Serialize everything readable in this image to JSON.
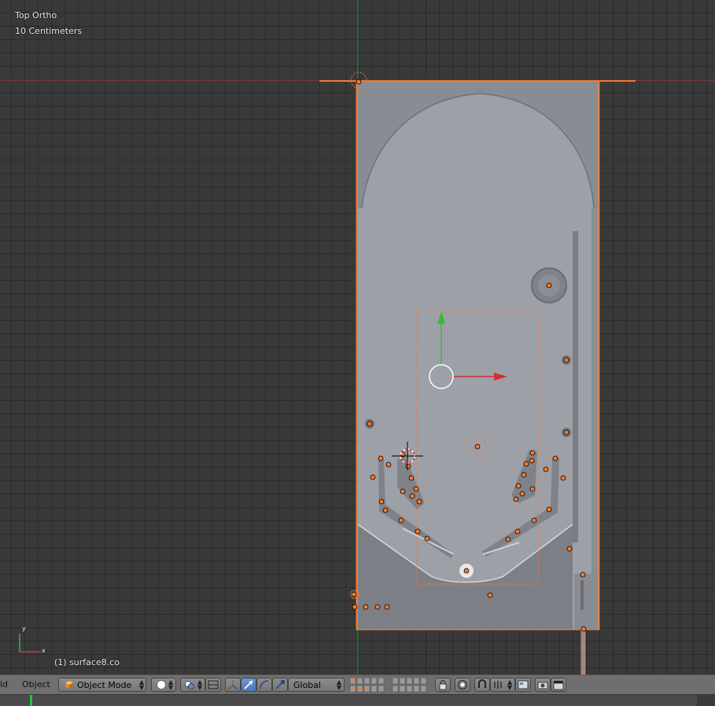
{
  "viewport": {
    "view_name": "Top Ortho",
    "grid_scale": "10 Centimeters",
    "object_info": "(1) surface8.co",
    "axis_x_label": "x",
    "axis_y_label": "y"
  },
  "header": {
    "truncated_menu": "ld",
    "object_menu": "Object",
    "mode_select": "Object Mode",
    "orientation_select": "Global"
  },
  "icons": [
    "view-type-icon",
    "mode-cube-icon",
    "shading-sphere-icon",
    "pivot-icon",
    "manipulator-toggle-icon",
    "translate-icon",
    "rotate-icon",
    "scale-icon",
    "layers-grid-icon",
    "lock-icon",
    "snap-icon",
    "proportional-icon",
    "render-camera-icon",
    "clapper-icon"
  ],
  "colors": {
    "viewport_bg": "#393939",
    "selection_outline": "#f0782c",
    "x_axis": "#c83c3c",
    "y_axis": "#3ca03c",
    "header_bg": "#6f6f6f",
    "frame_marker": "#22cc22"
  }
}
